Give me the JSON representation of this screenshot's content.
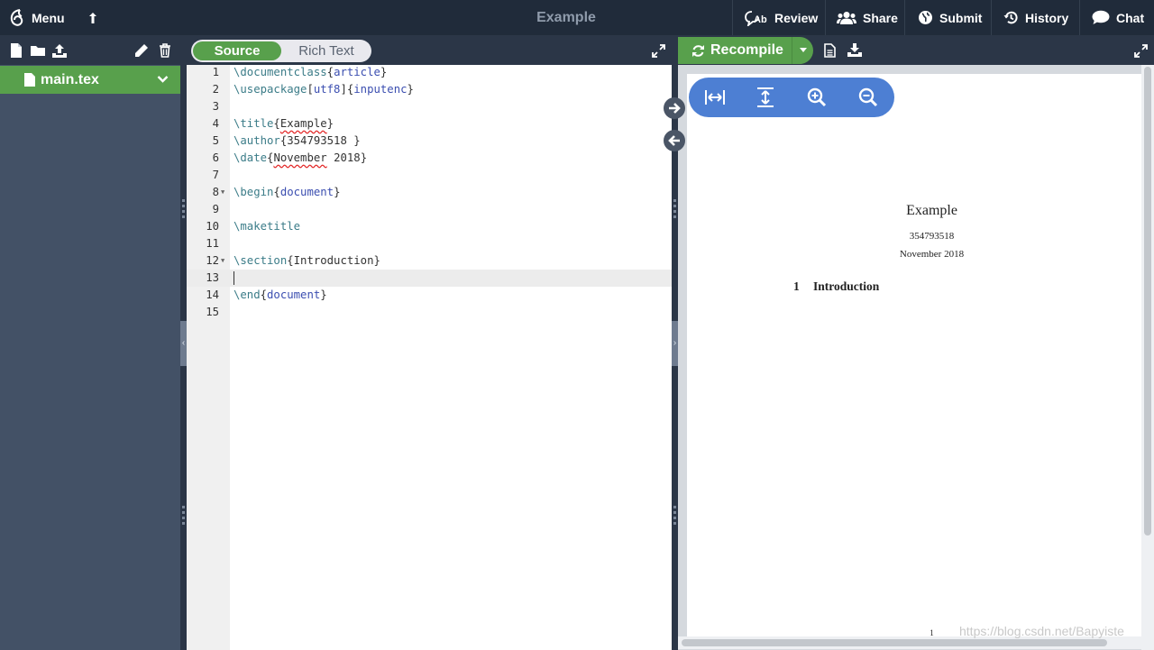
{
  "header": {
    "menu_label": "Menu",
    "project_title": "Example",
    "actions": [
      {
        "label": "Review",
        "icon": "review-icon"
      },
      {
        "label": "Share",
        "icon": "users-icon"
      },
      {
        "label": "Submit",
        "icon": "globe-icon"
      },
      {
        "label": "History",
        "icon": "history-icon"
      },
      {
        "label": "Chat",
        "icon": "chat-bubble-icon"
      }
    ]
  },
  "file_tree": {
    "toolbar_icons": [
      "new-file-icon",
      "new-folder-icon",
      "upload-icon",
      "rename-pencil-icon",
      "delete-trash-icon"
    ],
    "files": [
      {
        "name": "main.tex",
        "selected": true
      }
    ]
  },
  "editor": {
    "modes": {
      "source": "Source",
      "rich_text": "Rich Text",
      "active": "Source"
    },
    "active_line": 13,
    "lines": [
      {
        "n": "1",
        "text": "\\documentclass{article}"
      },
      {
        "n": "2",
        "text": "\\usepackage[utf8]{inputenc}"
      },
      {
        "n": "3",
        "text": ""
      },
      {
        "n": "4",
        "text": "\\title{Example}"
      },
      {
        "n": "5",
        "text": "\\author{354793518 }"
      },
      {
        "n": "6",
        "text": "\\date{November 2018}"
      },
      {
        "n": "7",
        "text": ""
      },
      {
        "n": "8",
        "text": "\\begin{document}"
      },
      {
        "n": "9",
        "text": ""
      },
      {
        "n": "10",
        "text": "\\maketitle"
      },
      {
        "n": "11",
        "text": ""
      },
      {
        "n": "12",
        "text": "\\section{Introduction}"
      },
      {
        "n": "13",
        "text": ""
      },
      {
        "n": "14",
        "text": "\\end{document}"
      },
      {
        "n": "15",
        "text": ""
      }
    ]
  },
  "pdf": {
    "recompile_label": "Recompile",
    "toolbar_icons": [
      "log-file-icon",
      "download-icon",
      "expand-icon"
    ],
    "controls": [
      "fit-width-icon",
      "fit-height-icon",
      "zoom-in-icon",
      "zoom-out-icon"
    ],
    "page": {
      "title": "Example",
      "author": "354793518",
      "date": "November 2018",
      "section_number": "1",
      "section_title": "Introduction",
      "page_number": "1"
    }
  },
  "watermark": "https://blog.csdn.net/Bapyiste",
  "colors": {
    "header_bg": "#202b3a",
    "panel_dark": "#2b3647",
    "tree_bg": "#435166",
    "accent_green": "#58a04c",
    "pdf_controls_blue": "#4d7fd3"
  }
}
